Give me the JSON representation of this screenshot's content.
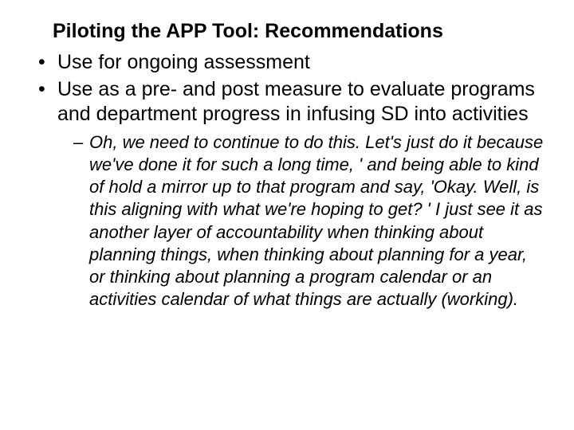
{
  "title": "Piloting the APP Tool: Recommendations",
  "bullets": [
    {
      "text": "Use for ongoing assessment"
    },
    {
      "text": "Use as a pre- and post measure to evaluate programs and department progress in infusing SD into activities",
      "sub": [
        {
          "text": "Oh, we need to continue to do this.  Let's just do it because we've done it for such a long time, ' and being able to kind of hold a mirror up to that program and say, 'Okay.  Well, is this aligning with what we're hoping to get? ' I just see it as another layer of accountability when thinking about planning things, when thinking about planning for a year, or thinking about planning a program calendar or an activities calendar of what things are actually (working)."
        }
      ]
    }
  ]
}
